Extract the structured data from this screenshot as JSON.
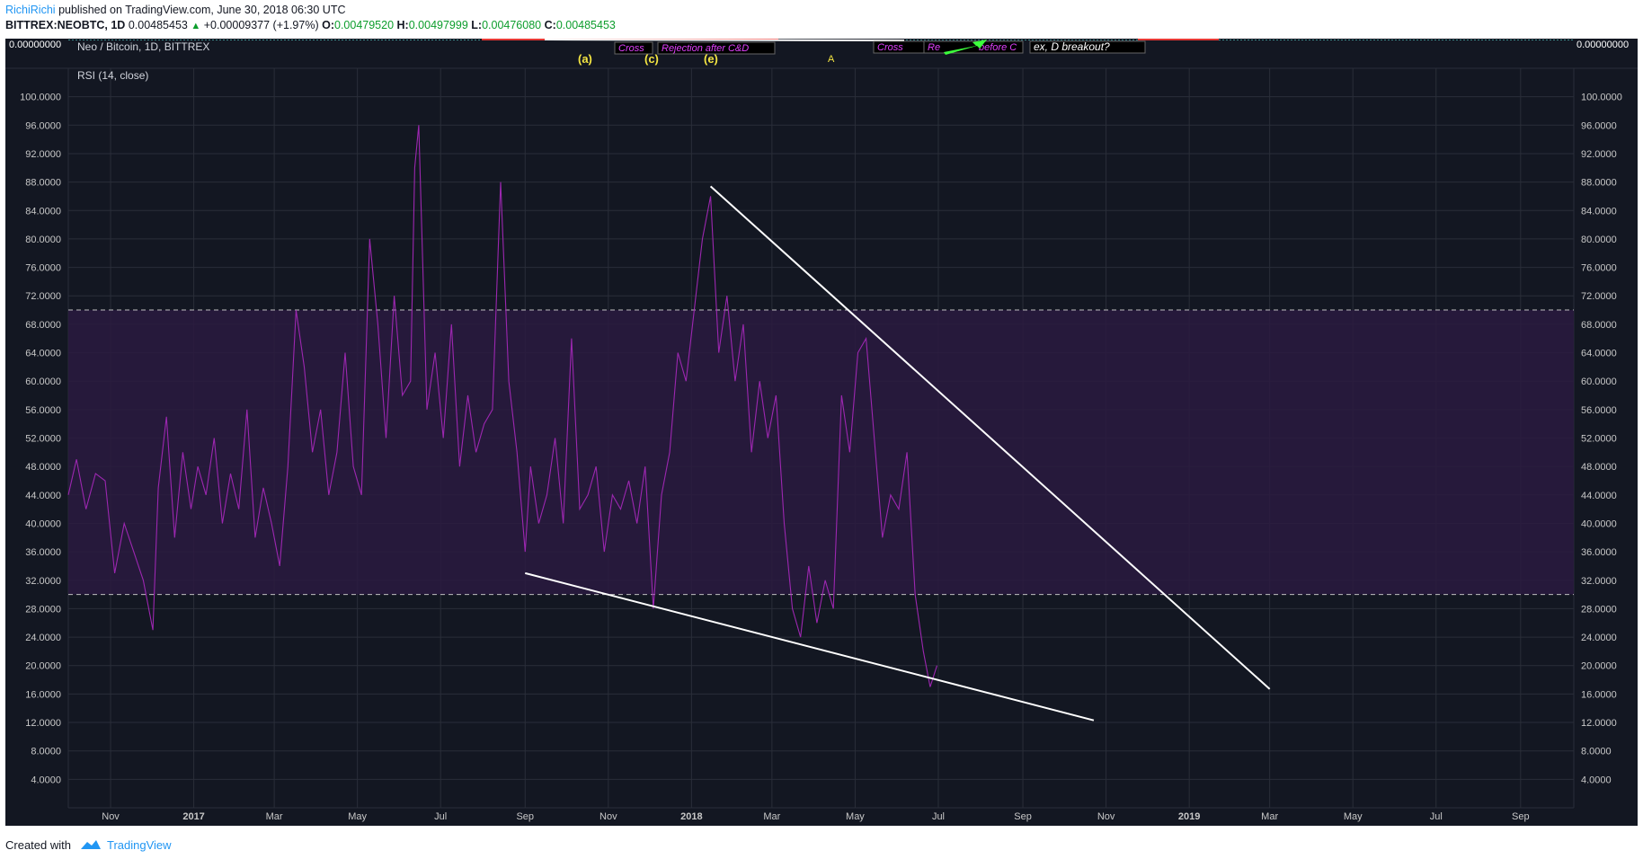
{
  "header": {
    "author": "RichiRichi",
    "published": "published on TradingView.com, June 30, 2018 06:30 UTC",
    "symbol": "BITTREX:NEOBTC, 1D",
    "last": "0.00485453",
    "change": "+0.00009377 (+1.97%)",
    "o_label": "O:",
    "o": "0.00479520",
    "h_label": "H:",
    "h": "0.00497999",
    "l_label": "L:",
    "l": "0.00476080",
    "c_label": "C:",
    "c": "0.00485453"
  },
  "footer": {
    "created": "Created with",
    "brand": "TradingView"
  },
  "top_pane": {
    "title": "Neo / Bitcoin, 1D, BITTREX",
    "price_label": "0.00000000",
    "annotations": [
      "Cross",
      "Rejection after C&D",
      "Cross",
      "Re",
      "before C",
      "ex, D breakout?"
    ],
    "wave_labels": [
      "(a)",
      "(c)",
      "(e)",
      "A"
    ]
  },
  "colors": {
    "background": "#131722",
    "rsi_line": "#9c27b0",
    "band_fill": "#2a1a3f",
    "band_lines": "#c0c0c0",
    "trendlines": "#ffffff",
    "grid": "#2a2e39",
    "axis_text": "#c8c8c8",
    "wave_labels": "#f5e642",
    "annotation_text": "#e040fb",
    "green_arrow": "#3cff3c"
  },
  "chart_data": {
    "type": "line",
    "title": "RSI (14, close)",
    "ylim": [
      0,
      104
    ],
    "yticks": [
      4,
      8,
      12,
      16,
      20,
      24,
      28,
      32,
      36,
      40,
      44,
      48,
      52,
      56,
      60,
      64,
      68,
      72,
      76,
      80,
      84,
      88,
      92,
      96,
      100
    ],
    "xrange": [
      "2016-10-01",
      "2019-10-10"
    ],
    "xticks": [
      {
        "date": "2016-11-01",
        "label": "Nov"
      },
      {
        "date": "2017-01-01",
        "label": "2017"
      },
      {
        "date": "2017-03-01",
        "label": "Mar"
      },
      {
        "date": "2017-05-01",
        "label": "May"
      },
      {
        "date": "2017-07-01",
        "label": "Jul"
      },
      {
        "date": "2017-09-01",
        "label": "Sep"
      },
      {
        "date": "2017-11-01",
        "label": "Nov"
      },
      {
        "date": "2018-01-01",
        "label": "2018"
      },
      {
        "date": "2018-03-01",
        "label": "Mar"
      },
      {
        "date": "2018-05-01",
        "label": "May"
      },
      {
        "date": "2018-07-01",
        "label": "Jul"
      },
      {
        "date": "2018-09-01",
        "label": "Sep"
      },
      {
        "date": "2018-11-01",
        "label": "Nov"
      },
      {
        "date": "2019-01-01",
        "label": "2019"
      },
      {
        "date": "2019-03-01",
        "label": "Mar"
      },
      {
        "date": "2019-05-01",
        "label": "May"
      },
      {
        "date": "2019-07-01",
        "label": "Jul"
      },
      {
        "date": "2019-09-01",
        "label": "Sep"
      }
    ],
    "bands": {
      "upper": 70,
      "lower": 30
    },
    "grid": true,
    "series": [
      {
        "x": [
          "2016-10-01",
          "2016-10-07",
          "2016-10-14",
          "2016-10-21",
          "2016-10-28",
          "2016-11-04",
          "2016-11-11",
          "2016-11-18",
          "2016-11-25",
          "2016-12-02",
          "2016-12-06",
          "2016-12-12",
          "2016-12-18",
          "2016-12-24",
          "2016-12-30",
          "2017-01-04",
          "2017-01-10",
          "2017-01-16",
          "2017-01-22",
          "2017-01-28",
          "2017-02-03",
          "2017-02-09",
          "2017-02-15",
          "2017-02-21",
          "2017-02-27",
          "2017-03-05",
          "2017-03-11",
          "2017-03-17",
          "2017-03-23",
          "2017-03-29",
          "2017-04-04",
          "2017-04-10",
          "2017-04-16",
          "2017-04-22",
          "2017-04-28",
          "2017-05-04",
          "2017-05-10",
          "2017-05-16",
          "2017-05-22",
          "2017-05-28",
          "2017-06-03",
          "2017-06-09",
          "2017-06-12",
          "2017-06-15",
          "2017-06-21",
          "2017-06-27",
          "2017-07-03",
          "2017-07-09",
          "2017-07-15",
          "2017-07-21",
          "2017-07-27",
          "2017-08-02",
          "2017-08-08",
          "2017-08-14",
          "2017-08-20",
          "2017-08-26",
          "2017-09-01",
          "2017-09-05",
          "2017-09-11",
          "2017-09-17",
          "2017-09-23",
          "2017-09-29",
          "2017-10-05",
          "2017-10-11",
          "2017-10-17",
          "2017-10-23",
          "2017-10-29",
          "2017-11-04",
          "2017-11-10",
          "2017-11-16",
          "2017-11-22",
          "2017-11-28",
          "2017-12-04",
          "2017-12-10",
          "2017-12-16",
          "2017-12-22",
          "2017-12-28",
          "2018-01-03",
          "2018-01-09",
          "2018-01-15",
          "2018-01-21",
          "2018-01-27",
          "2018-02-02",
          "2018-02-08",
          "2018-02-14",
          "2018-02-20",
          "2018-02-26",
          "2018-03-04",
          "2018-03-10",
          "2018-03-16",
          "2018-03-22",
          "2018-03-28",
          "2018-04-03",
          "2018-04-09",
          "2018-04-15",
          "2018-04-21",
          "2018-04-27",
          "2018-05-03",
          "2018-05-09",
          "2018-05-15",
          "2018-05-21",
          "2018-05-27",
          "2018-06-02",
          "2018-06-08",
          "2018-06-14",
          "2018-06-20",
          "2018-06-25",
          "2018-06-30"
        ],
        "y": [
          44,
          49,
          42,
          47,
          46,
          33,
          40,
          36,
          32,
          25,
          45,
          55,
          38,
          50,
          42,
          48,
          44,
          52,
          40,
          47,
          42,
          56,
          38,
          45,
          40,
          34,
          48,
          70,
          62,
          50,
          56,
          44,
          50,
          64,
          48,
          44,
          80,
          68,
          52,
          72,
          58,
          60,
          90,
          96,
          56,
          64,
          52,
          68,
          48,
          58,
          50,
          54,
          56,
          88,
          60,
          50,
          36,
          48,
          40,
          44,
          52,
          40,
          66,
          42,
          44,
          48,
          36,
          44,
          42,
          46,
          40,
          48,
          28,
          44,
          50,
          64,
          60,
          70,
          80,
          86,
          64,
          72,
          60,
          68,
          50,
          60,
          52,
          58,
          40,
          28,
          24,
          34,
          26,
          32,
          28,
          58,
          50,
          64,
          66,
          52,
          38,
          44,
          42,
          50,
          30,
          22,
          17,
          20
        ]
      }
    ],
    "trendlines": [
      {
        "from": {
          "x": "2018-01-15",
          "y": 87.4
        },
        "to": {
          "x": "2019-03-01",
          "y": 16.7
        }
      },
      {
        "from": {
          "x": "2017-09-01",
          "y": 33
        },
        "to": {
          "x": "2018-10-23",
          "y": 12.3
        }
      }
    ]
  }
}
